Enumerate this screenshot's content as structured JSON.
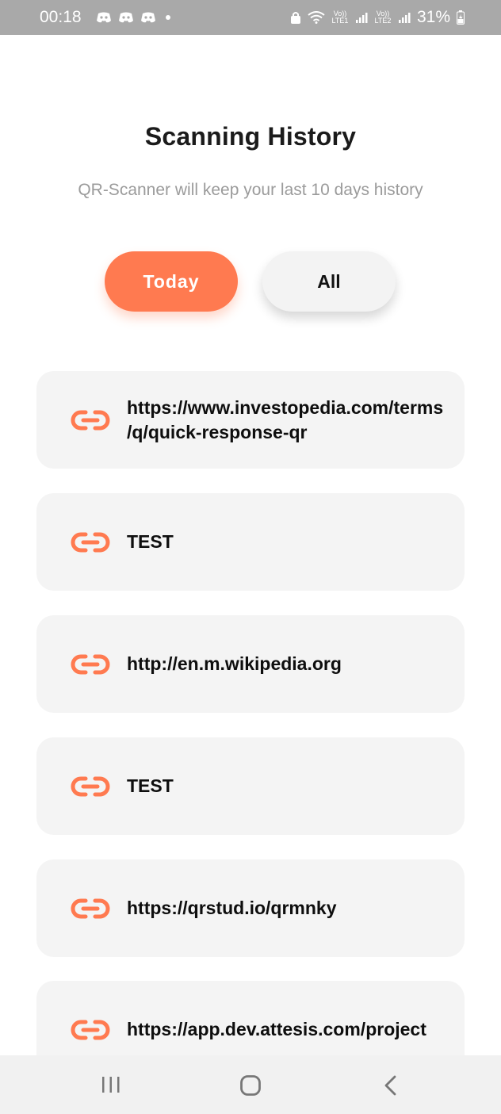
{
  "status_bar": {
    "time": "00:18",
    "sim1_label": "Vo)) LTE1",
    "sim2_label": "Vo)) LTE2",
    "battery": "31%"
  },
  "header": {
    "title": "Scanning History",
    "subtitle": "QR-Scanner will keep your last 10 days history"
  },
  "filters": {
    "today_label": "Today",
    "all_label": "All",
    "active": "Today"
  },
  "history": {
    "items": [
      {
        "text": "https://www.investopedia.com/terms/q/quick-response-qr",
        "icon": "link-icon"
      },
      {
        "text": "TEST",
        "icon": "link-icon"
      },
      {
        "text": "http://en.m.wikipedia.org",
        "icon": "link-icon"
      },
      {
        "text": "TEST",
        "icon": "link-icon"
      },
      {
        "text": "https://qrstud.io/qrmnky",
        "icon": "link-icon"
      },
      {
        "text": "https://app.dev.attesis.com/project",
        "icon": "link-icon"
      }
    ]
  },
  "nav": {
    "recents_icon": "recents-icon",
    "home_icon": "home-icon",
    "back_icon": "back-icon"
  },
  "colors": {
    "accent": "#ff7a50",
    "card_bg": "#f4f4f4",
    "status_bar_bg": "#a9a9a9"
  }
}
